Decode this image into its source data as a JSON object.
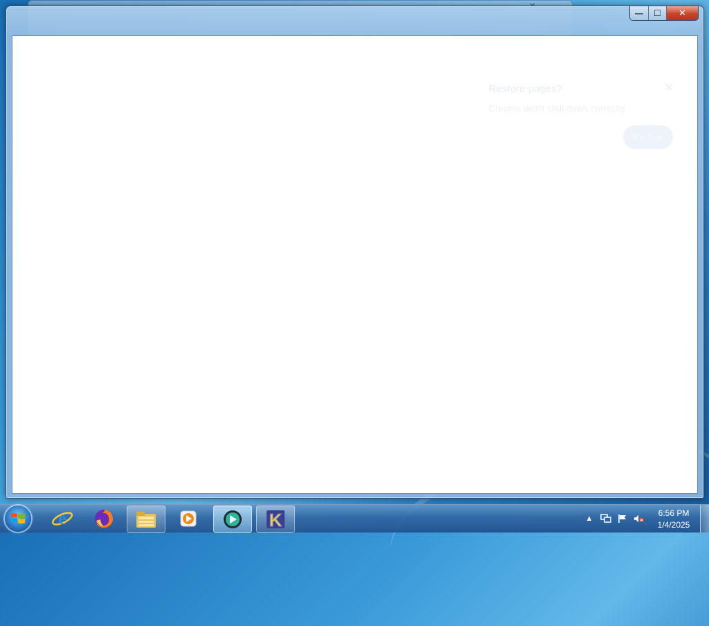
{
  "background_window": {
    "controls": [
      "—",
      "✕"
    ]
  },
  "window": {
    "caption_buttons": {
      "minimize": "—",
      "maximize": "☐",
      "close": "✕"
    },
    "ghost_dialog": {
      "title": "Restore pages?",
      "close": "✕",
      "description": "Chrome didn't shut down correctly.",
      "button": "Restore"
    }
  },
  "taskbar": {
    "start_icon": "windows-logo-icon",
    "pinned": [
      {
        "name": "internet-explorer-icon",
        "state": "normal"
      },
      {
        "name": "firefox-icon",
        "state": "normal"
      },
      {
        "name": "file-explorer-icon",
        "state": "open"
      },
      {
        "name": "media-player-icon",
        "state": "normal"
      },
      {
        "name": "app-icon",
        "state": "active"
      },
      {
        "name": "k-app-icon",
        "state": "open"
      }
    ],
    "tray": {
      "show_hidden": "▲",
      "icons": [
        "network-icon",
        "action-center-flag-icon",
        "volume-muted-icon"
      ]
    },
    "clock": {
      "time": "6:56 PM",
      "date": "1/4/2025"
    }
  },
  "colors": {
    "close_button": "#c9462c",
    "taskbar": "#2f6aa8",
    "window_frame": "#9ebfe0"
  }
}
